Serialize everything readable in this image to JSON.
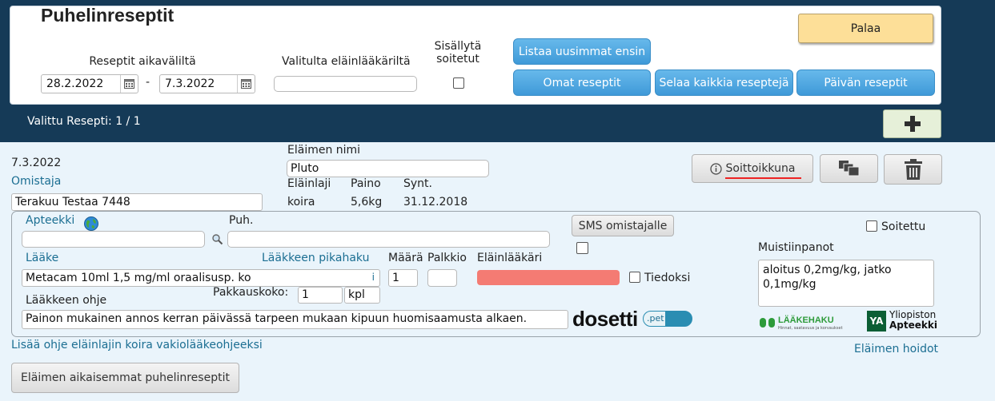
{
  "header": {
    "title": "Puhelinreseptit",
    "range_label": "Reseptit aikaväliltä",
    "date_from": "28.2.2022",
    "date_sep": "-",
    "date_to": "7.3.2022",
    "vet_label": "Valitulta eläinlääkäriltä",
    "vet_value": "",
    "include_called_label_1": "Sisällytä",
    "include_called_label_2": "soitetut",
    "list_newest": "Listaa uusimmat ensin",
    "own_prescriptions": "Omat reseptit",
    "browse_all": "Selaa kaikkia reseptejä",
    "day_prescriptions": "Päivän reseptit",
    "back": "Palaa",
    "selected": "Valittu Resepti: 1 / 1"
  },
  "record": {
    "date": "7.3.2022",
    "owner_label": "Omistaja",
    "owner_value": "Terakuu Testaa 7448",
    "animal_name_label": "Eläimen nimi",
    "animal_name_value": "Pluto",
    "species_label": "Eläinlaji",
    "species_value": "koira",
    "weight_label": "Paino",
    "weight_value": "5,6kg",
    "birth_label": "Synt.",
    "birth_value": "31.12.2018",
    "call_window_button": "Soittoikkuna"
  },
  "form": {
    "pharmacy_label": "Apteekki",
    "phone_label": "Puh.",
    "sms_button": "SMS omistajalle",
    "called_label": "Soitettu",
    "drug_label": "Lääke",
    "drug_quick_label": "Lääkkeen pikahaku",
    "amount_label": "Määrä",
    "fee_label": "Palkkio",
    "vet_label": "Eläinlääkäri",
    "drug_value": "Metacam 10ml 1,5 mg/ml oraalisusp. ko",
    "drug_info": "i",
    "amount_value": "1",
    "fee_value": "",
    "inform_label": "Tiedoksi",
    "notes_label": "Muistiinpanot",
    "notes_value": "aloitus 0,2mg/kg, jatko 0,1mg/kg",
    "package_label": "Pakkauskoko:",
    "package_value": "1",
    "package_unit": "kpl",
    "instructions_label": "Lääkkeen ohje",
    "instructions_value": "Painon mukainen annos kerran päivässä tarpeen mukaan kipuun huomisaamusta alkaen.",
    "dosetti_logo": "dosetti",
    "dosetti_pet": ".pet",
    "laakehaku_logo": "LÄÄKEHAKU",
    "laakehaku_tagline": "Hinnat, saatavuus ja korvaukset",
    "yliopiston_logo_mark": "YA",
    "yliopiston_1": "Yliopiston",
    "yliopiston_2": "Apteekki"
  },
  "footer": {
    "add_instruction_link": "Lisää ohje eläinlajin koira vakiolääkeohjeeksi",
    "animal_care_link": "Eläimen hoidot",
    "previous_button": "Eläimen aikaisemmat puhelinreseptit"
  },
  "colors": {
    "header_bg": "#153a57",
    "accent_blue": "#3f9ad8",
    "vet_field_error": "#f47b73",
    "palaa_bg": "#fddf98",
    "link": "#1b6e92"
  }
}
